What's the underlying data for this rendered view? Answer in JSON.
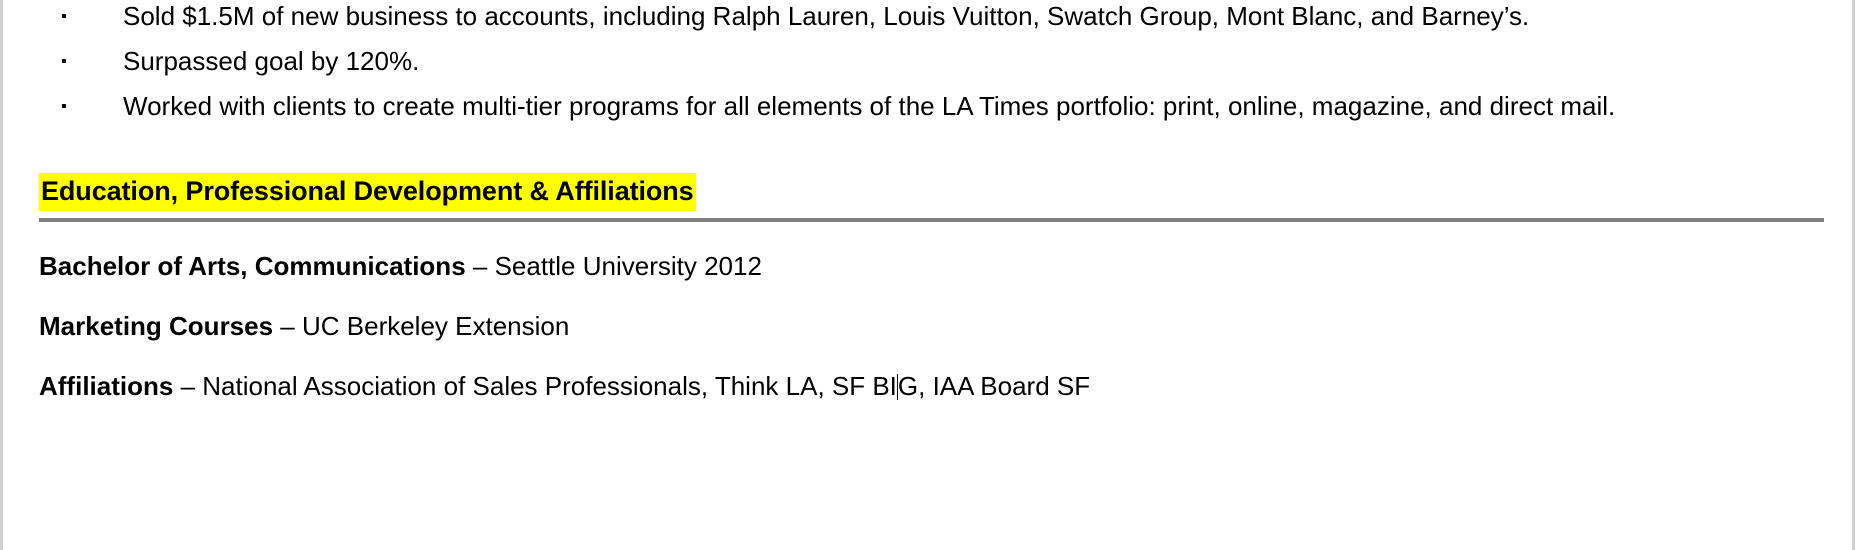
{
  "document": {
    "bullets": [
      {
        "marker": "▪",
        "text": "Sold $1.5M of new business to accounts, including Ralph Lauren, Louis Vuitton, Swatch Group, Mont Blanc, and Barney’s."
      },
      {
        "marker": "▪",
        "text": "Surpassed goal by 120%."
      },
      {
        "marker": "▪",
        "text": "Worked with clients to create multi-tier programs for all elements of the LA Times portfolio: print, online, magazine, and direct mail."
      }
    ],
    "section": {
      "heading": "Education, Professional Development & Affiliations",
      "highlight_color": "#ffff00",
      "rule_color": "#808080"
    },
    "entries": [
      {
        "lead": "Bachelor of Arts, Communications",
        "rest": " – Seattle University 2012"
      },
      {
        "lead": "Marketing Courses",
        "rest": " – UC Berkeley Extension"
      },
      {
        "lead": "Affiliations",
        "rest_before_caret": " – National Association of Sales Professionals, Think LA, SF BI",
        "rest_after_caret": "G, IAA Board SF"
      }
    ]
  }
}
